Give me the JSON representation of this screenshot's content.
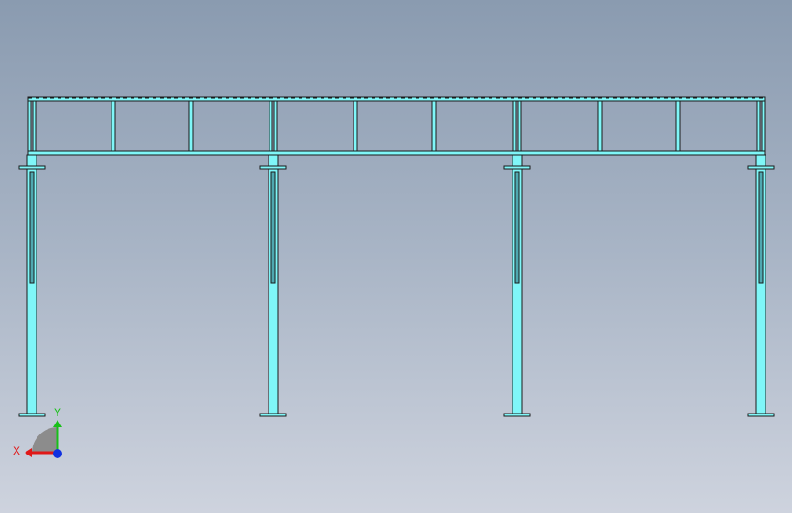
{
  "viewport": {
    "background_top": "#8a9bb0",
    "background_bottom": "#ced3de"
  },
  "model": {
    "steel_color": "#7ff6f8",
    "edge_color": "#1a1a1a",
    "columns": 4,
    "bays": 3,
    "panels_per_bay": 3
  },
  "triad": {
    "x_label": "X",
    "y_label": "Y",
    "x_color": "#e01818",
    "y_color": "#18c018",
    "z_color": "#1030e0"
  }
}
